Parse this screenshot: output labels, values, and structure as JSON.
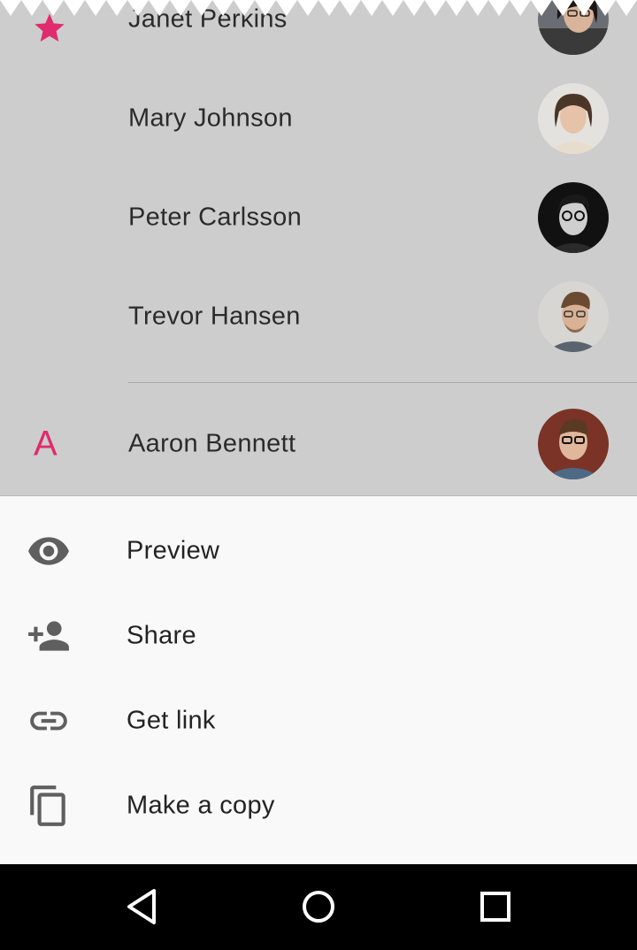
{
  "contacts": [
    {
      "name": "Janet Perkins",
      "starred": true,
      "avatar": "avatar-janet"
    },
    {
      "name": "Mary Johnson",
      "avatar": "avatar-mary"
    },
    {
      "name": "Peter Carlsson",
      "avatar": "avatar-peter"
    },
    {
      "name": "Trevor Hansen",
      "avatar": "avatar-trevor"
    },
    {
      "name": "Aaron Bennett",
      "section_letter": "A",
      "avatar": "avatar-aaron"
    }
  ],
  "bottom_sheet": {
    "items": [
      {
        "label": "Preview",
        "icon": "eye-icon"
      },
      {
        "label": "Share",
        "icon": "person-add-icon"
      },
      {
        "label": "Get link",
        "icon": "link-icon"
      },
      {
        "label": "Make a copy",
        "icon": "copy-icon"
      }
    ]
  },
  "navbar": {
    "buttons": [
      "back-icon",
      "home-icon",
      "recents-icon"
    ]
  },
  "colors": {
    "accent": "#e02b6e",
    "scrim": "#cdcdcd",
    "sheet": "#f9f9f9",
    "icon": "#5f5f5f"
  }
}
